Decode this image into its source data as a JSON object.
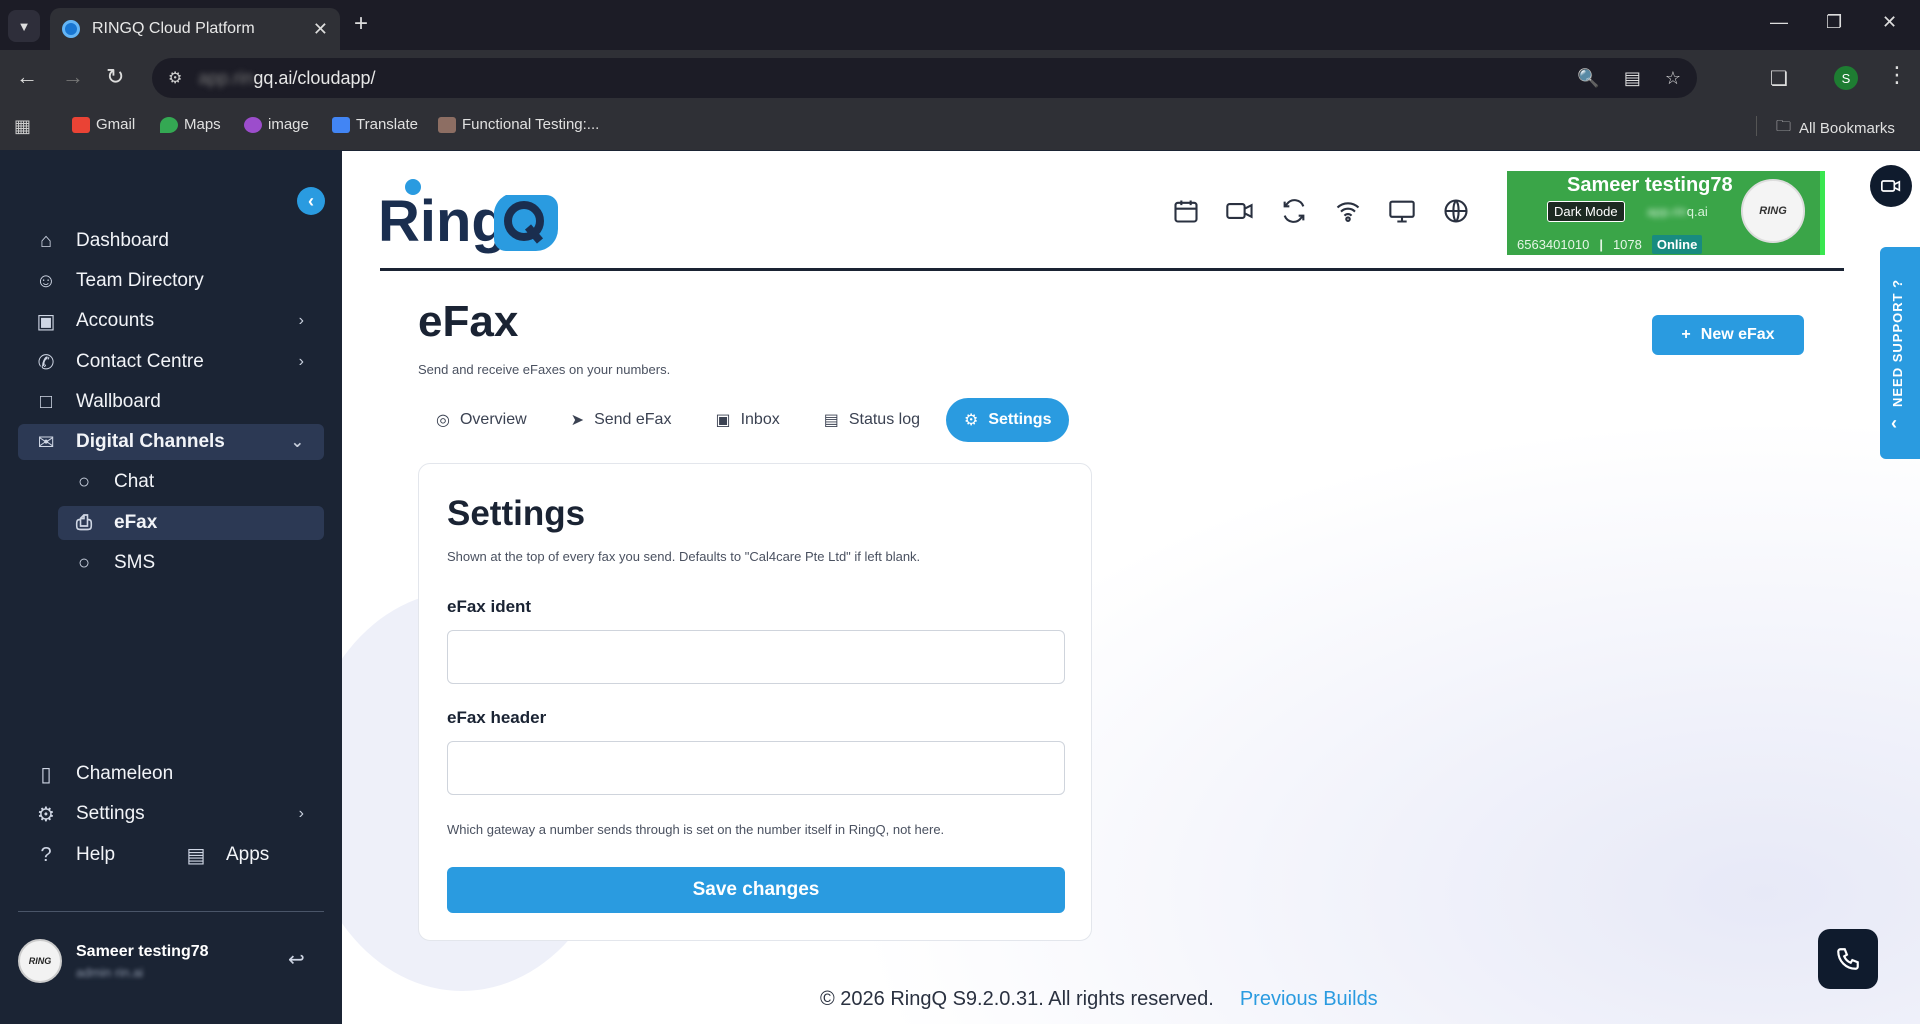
{
  "browser": {
    "tab_title": "RINGQ Cloud Platform",
    "url_hidden": "app.rin",
    "url_visible": "gq.ai/cloudapp/",
    "profile_initial": "S",
    "bookmarks": [
      {
        "label": "Gmail",
        "color": "#ea4335"
      },
      {
        "label": "Maps",
        "color": "#34a853"
      },
      {
        "label": "image",
        "color": "#9c4dcc"
      },
      {
        "label": "Translate",
        "color": "#4285f4"
      },
      {
        "label": "Functional Testing:...",
        "color": "#8d6e63"
      }
    ],
    "all_bookmarks": "All Bookmarks"
  },
  "sidebar": {
    "items": [
      {
        "label": "Dashboard",
        "icon": "home-icon"
      },
      {
        "label": "Team Directory",
        "icon": "user-icon"
      },
      {
        "label": "Accounts",
        "icon": "account-icon"
      },
      {
        "label": "Contact Centre",
        "icon": "phone-icon"
      },
      {
        "label": "Wallboard",
        "icon": "square-icon"
      },
      {
        "label": "Digital Channels",
        "icon": "chat-bubble-icon"
      }
    ],
    "sub_items": [
      {
        "label": "Chat",
        "icon": "chat-icon"
      },
      {
        "label": "eFax",
        "icon": "printer-icon"
      },
      {
        "label": "SMS",
        "icon": "sms-icon"
      }
    ],
    "bottom_items": [
      {
        "label": "Chameleon",
        "icon": "clipboard-icon"
      },
      {
        "label": "Settings",
        "icon": "gear-icon"
      },
      {
        "label": "Help",
        "icon": "help-icon"
      },
      {
        "label": "Apps",
        "icon": "apps-icon"
      }
    ],
    "user": {
      "name": "Sameer testing78",
      "sub": "admin rin.ai"
    }
  },
  "header": {
    "logo_text": "Ring",
    "user_card": {
      "name": "Sameer testing78",
      "mode_label": "Dark Mode",
      "domain_hidden": "app.rin",
      "domain_visible": "q.ai",
      "number": "6563401010",
      "ext": "1078",
      "status": "Online",
      "bg_color": "#3aa548"
    },
    "support_label": "NEED SUPPORT ?"
  },
  "page": {
    "title": "eFax",
    "subtitle": "Send and receive eFaxes on your numbers.",
    "new_button": "New eFax",
    "tabs": [
      {
        "label": "Overview",
        "icon": "eye-icon"
      },
      {
        "label": "Send eFax",
        "icon": "send-icon"
      },
      {
        "label": "Inbox",
        "icon": "inbox-icon"
      },
      {
        "label": "Status log",
        "icon": "document-icon"
      },
      {
        "label": "Settings",
        "icon": "gear-icon",
        "active": true
      }
    ]
  },
  "settings_card": {
    "title": "Settings",
    "subtitle": "Shown at the top of every fax you send. Defaults to \"Cal4care Pte Ltd\" if left blank.",
    "ident_label": "eFax ident",
    "ident_value": "",
    "header_label": "eFax header",
    "header_value": "",
    "note": "Which gateway a number sends through is set on the number itself in RingQ, not here.",
    "save_label": "Save changes"
  },
  "footer": {
    "copyright": "© 2026 RingQ S9.2.0.31. All rights reserved.",
    "previous_builds": "Previous Builds"
  },
  "colors": {
    "accent": "#2a9be0",
    "sidebar_bg": "#1b2434",
    "online": "#188b80"
  }
}
